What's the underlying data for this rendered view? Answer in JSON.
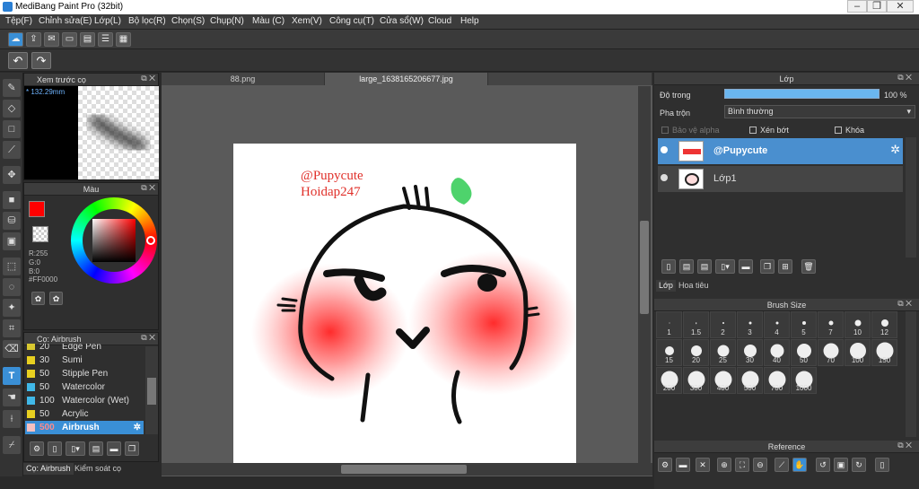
{
  "app": {
    "title": "MediBang Paint Pro (32bit)"
  },
  "menu": [
    "Tệp(F)",
    "Chỉnh sửa(E)",
    "Lớp(L)",
    "Bộ lọc(R)",
    "Chọn(S)",
    "Chụp(N)",
    "Màu (C)",
    "Xem(V)",
    "Công cụ(T)",
    "Cửa sổ(W)",
    "Cloud",
    "Help"
  ],
  "brush_preview": {
    "title": "Xem trước cọ",
    "size": "* 132.29mm"
  },
  "color_panel": {
    "title": "Màu",
    "r": "R:255",
    "g": "G:0",
    "b": "B:0",
    "hex": "#FF0000",
    "primary_color": "#FF0000"
  },
  "brush_panel": {
    "title": "Cọ: Airbrush",
    "items": [
      {
        "size": "20",
        "name": "Edge Pen",
        "color": "#d8c830"
      },
      {
        "size": "30",
        "name": "Sumi",
        "color": "#e8d020"
      },
      {
        "size": "50",
        "name": "Stipple Pen",
        "color": "#e8d020"
      },
      {
        "size": "50",
        "name": "Watercolor",
        "color": "#40b8e8"
      },
      {
        "size": "100",
        "name": "Watercolor (Wet)",
        "color": "#40b8e8"
      },
      {
        "size": "50",
        "name": "Acrylic",
        "color": "#e8d020"
      },
      {
        "size": "500",
        "name": "Airbrush",
        "color": "#f4c0c0",
        "selected": true
      }
    ],
    "tabs": [
      "Cọ: Airbrush",
      "Kiểm soát cọ"
    ]
  },
  "documents": {
    "tabs": [
      "88.png",
      "large_1638165206677.jpg"
    ],
    "active": 1
  },
  "canvas_text": {
    "line1": "@Pupycute",
    "line2": "Hoidap247"
  },
  "layers": {
    "title": "Lớp",
    "opacity_label": "Độ trong",
    "opacity_value": "100 %",
    "blend_label": "Pha trộn",
    "blend_value": "Bình thường",
    "protect_alpha": "Bảo vệ alpha",
    "clip": "Xén bớt",
    "lock": "Khóa",
    "items": [
      {
        "name": "@Pupycute",
        "selected": true
      },
      {
        "name": "Lớp1",
        "selected": false
      }
    ],
    "tabs": [
      "Lớp",
      "Hoa tiêu"
    ]
  },
  "brush_size": {
    "title": "Brush Size",
    "sizes": [
      "1",
      "1.5",
      "2",
      "3",
      "4",
      "5",
      "7",
      "10",
      "12",
      "15",
      "20",
      "25",
      "30",
      "40",
      "50",
      "70",
      "100",
      "150",
      "200",
      "300",
      "400",
      "500",
      "700",
      "1000"
    ]
  },
  "reference": {
    "title": "Reference"
  },
  "colors": {
    "accent": "#3a8fd6",
    "selected_layer": "#4a8fcf"
  }
}
